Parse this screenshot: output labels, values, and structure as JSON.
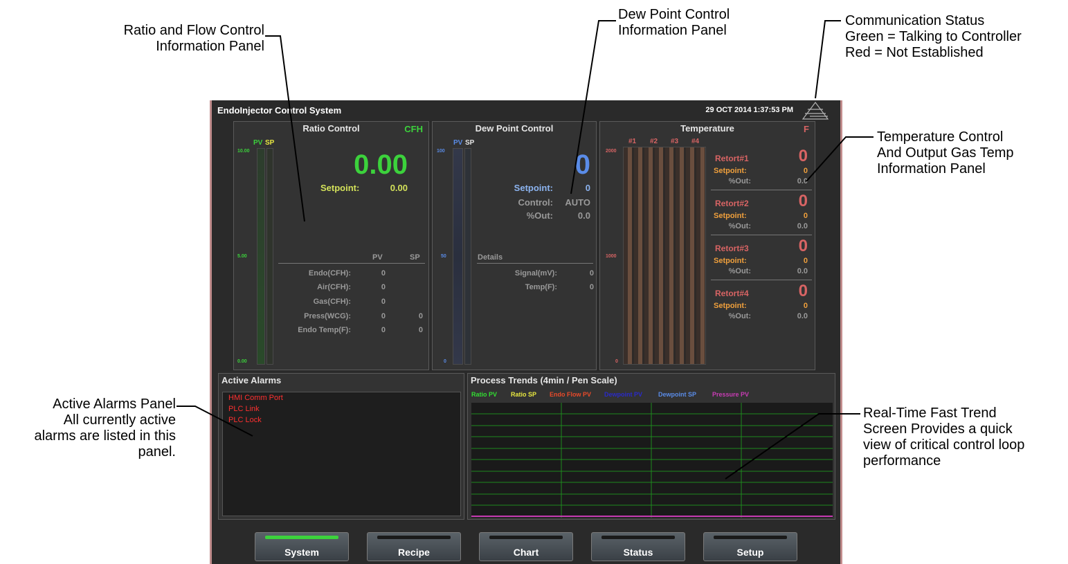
{
  "callouts": {
    "ratio_flow": [
      "Ratio and Flow Control",
      "Information Panel"
    ],
    "dew_point": [
      "Dew Point Control",
      "Information Panel"
    ],
    "comm_status": [
      "Communication Status",
      "Green = Talking to Controller",
      "Red = Not Established"
    ],
    "temp_control": [
      "Temperature Control",
      "And Output Gas Temp",
      "Information Panel"
    ],
    "active_alarms": [
      "Active Alarms Panel",
      "All currently active",
      "alarms are listed in this",
      "panel."
    ],
    "trend": [
      "Real-Time Fast Trend",
      "Screen Provides a quick",
      "view of critical control loop",
      "performance"
    ]
  },
  "app": {
    "title": "EndoInjector Control System",
    "datetime": "29 OCT 2014 1:37:53 PM",
    "comm_status_color": "#4a4a4a"
  },
  "ratio": {
    "title": "Ratio Control",
    "unit": "CFH",
    "pv_label": "PV",
    "sp_label": "SP",
    "ticks": [
      "10.00",
      "5.00",
      "0.00"
    ],
    "value": "0.00",
    "setpoint_label": "Setpoint:",
    "setpoint_value": "0.00",
    "col_pv": "PV",
    "col_sp": "SP",
    "rows": [
      {
        "label": "Endo(CFH):",
        "pv": "0",
        "sp": ""
      },
      {
        "label": "Air(CFH):",
        "pv": "0",
        "sp": ""
      },
      {
        "label": "Gas(CFH):",
        "pv": "0",
        "sp": ""
      },
      {
        "label": "Press(WCG):",
        "pv": "0",
        "sp": "0"
      },
      {
        "label": "Endo Temp(F):",
        "pv": "0",
        "sp": "0"
      }
    ]
  },
  "dew": {
    "title": "Dew Point Control",
    "pv_label": "PV",
    "sp_label": "SP",
    "ticks": [
      "100",
      "50",
      "0"
    ],
    "value": "0",
    "setpoint_label": "Setpoint:",
    "setpoint_value": "0",
    "control_label": "Control:",
    "control_value": "AUTO",
    "out_label": "%Out:",
    "out_value": "0.0",
    "details_label": "Details",
    "signal_label": "Signal(mV):",
    "signal_value": "0",
    "temp_label": "Temp(F):",
    "temp_value": "0"
  },
  "temperature": {
    "title": "Temperature",
    "unit": "F",
    "bar_labels": [
      "#1",
      "#2",
      "#3",
      "#4"
    ],
    "ticks": [
      "2000",
      "1000",
      "0"
    ],
    "retorts": [
      {
        "name": "Retort#1",
        "value": "0",
        "setpoint_label": "Setpoint:",
        "setpoint": "0",
        "out_label": "%Out:",
        "out": "0.0"
      },
      {
        "name": "Retort#2",
        "value": "0",
        "setpoint_label": "Setpoint:",
        "setpoint": "0",
        "out_label": "%Out:",
        "out": "0.0"
      },
      {
        "name": "Retort#3",
        "value": "0",
        "setpoint_label": "Setpoint:",
        "setpoint": "0",
        "out_label": "%Out:",
        "out": "0.0"
      },
      {
        "name": "Retort#4",
        "value": "0",
        "setpoint_label": "Setpoint:",
        "setpoint": "0",
        "out_label": "%Out:",
        "out": "0.0"
      }
    ]
  },
  "alarms": {
    "title": "Active Alarms",
    "items": [
      "HMI Comm Port",
      "PLC Link",
      "PLC Lock"
    ]
  },
  "trends": {
    "title": "Process Trends (4min / Pen Scale)",
    "legend": [
      {
        "name": "Ratio PV",
        "color": "#33dd33"
      },
      {
        "name": "Ratio SP",
        "color": "#e8e840"
      },
      {
        "name": "Endo Flow PV",
        "color": "#e84a2a"
      },
      {
        "name": "Dewpoint PV",
        "color": "#2a2ac8"
      },
      {
        "name": "Dewpoint SP",
        "color": "#5a8ce8"
      },
      {
        "name": "Pressure PV",
        "color": "#c83cb4"
      }
    ]
  },
  "nav": {
    "buttons": [
      {
        "label": "System",
        "active": true
      },
      {
        "label": "Recipe",
        "active": false
      },
      {
        "label": "Chart",
        "active": false
      },
      {
        "label": "Status",
        "active": false
      },
      {
        "label": "Setup",
        "active": false
      }
    ]
  }
}
